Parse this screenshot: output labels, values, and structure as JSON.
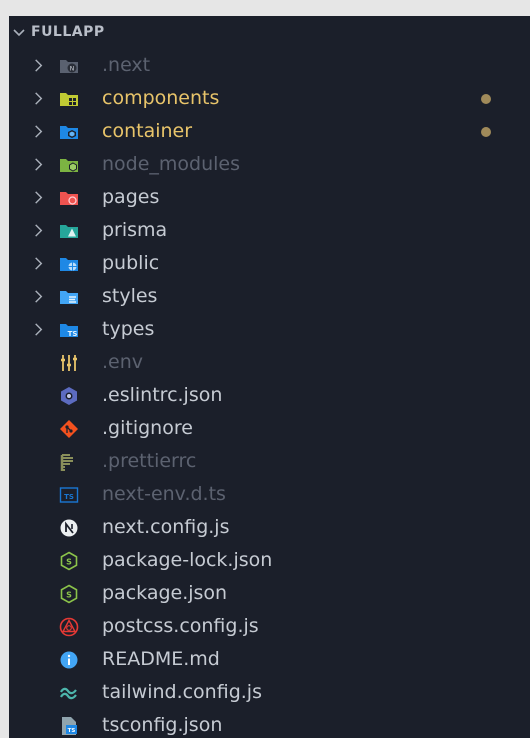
{
  "explorer": {
    "root_label": "FULLAPP",
    "items": [
      {
        "label": ".next",
        "kind": "folder",
        "icon": "next-folder-icon",
        "dim": true
      },
      {
        "label": "components",
        "kind": "folder",
        "icon": "components-folder-icon",
        "modified": true
      },
      {
        "label": "container",
        "kind": "folder",
        "icon": "container-folder-icon",
        "modified": true
      },
      {
        "label": "node_modules",
        "kind": "folder",
        "icon": "node-modules-folder-icon",
        "dim": true
      },
      {
        "label": "pages",
        "kind": "folder",
        "icon": "pages-folder-icon"
      },
      {
        "label": "prisma",
        "kind": "folder",
        "icon": "prisma-folder-icon"
      },
      {
        "label": "public",
        "kind": "folder",
        "icon": "public-folder-icon"
      },
      {
        "label": "styles",
        "kind": "folder",
        "icon": "styles-folder-icon"
      },
      {
        "label": "types",
        "kind": "folder",
        "icon": "types-folder-icon"
      },
      {
        "label": ".env",
        "kind": "file",
        "icon": "env-file-icon",
        "dim": true
      },
      {
        "label": ".eslintrc.json",
        "kind": "file",
        "icon": "eslint-icon"
      },
      {
        "label": ".gitignore",
        "kind": "file",
        "icon": "git-icon"
      },
      {
        "label": ".prettierrc",
        "kind": "file",
        "icon": "prettier-icon",
        "dim": true
      },
      {
        "label": "next-env.d.ts",
        "kind": "file",
        "icon": "typescript-def-icon",
        "dim": true
      },
      {
        "label": "next.config.js",
        "kind": "file",
        "icon": "nextjs-icon"
      },
      {
        "label": "package-lock.json",
        "kind": "file",
        "icon": "nodejs-icon"
      },
      {
        "label": "package.json",
        "kind": "file",
        "icon": "nodejs-icon"
      },
      {
        "label": "postcss.config.js",
        "kind": "file",
        "icon": "postcss-icon"
      },
      {
        "label": "README.md",
        "kind": "file",
        "icon": "info-icon"
      },
      {
        "label": "tailwind.config.js",
        "kind": "file",
        "icon": "tailwind-icon"
      },
      {
        "label": "tsconfig.json",
        "kind": "file",
        "icon": "tsconfig-icon"
      }
    ]
  },
  "colors": {
    "panel_bg": "#1b1f2a",
    "text": "#c6cbd3",
    "dim_text": "#5c6270",
    "modified_text": "#e8c46a",
    "modified_dot": "#a08a5a"
  }
}
